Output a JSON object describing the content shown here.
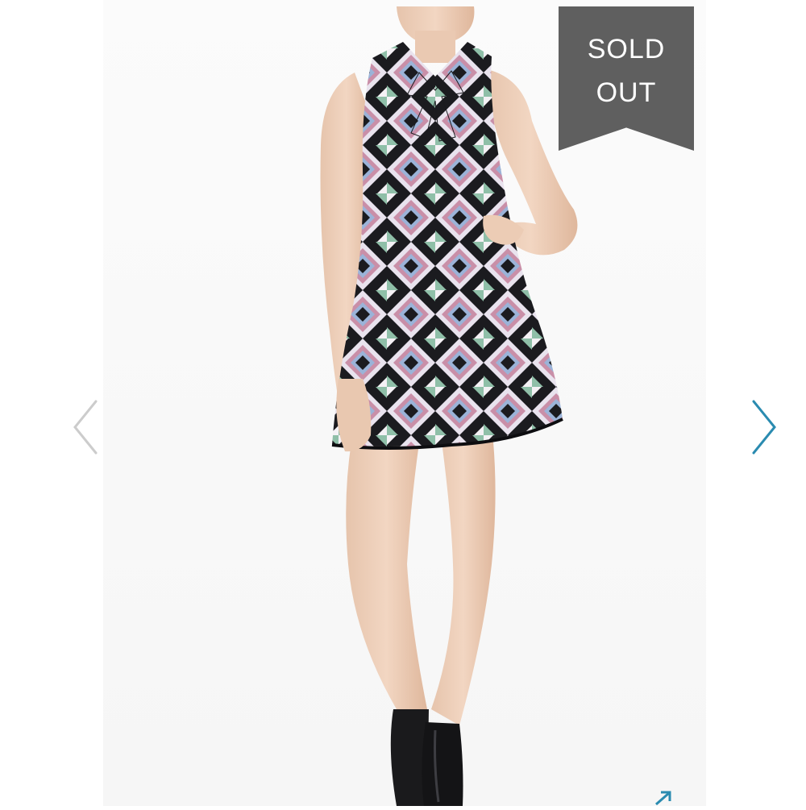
{
  "badge": {
    "line1": "SOLD",
    "line2": "OUT",
    "color": "#5f5f5f"
  },
  "gallery": {
    "prev_icon": "chevron-left-icon",
    "next_icon": "chevron-right-icon",
    "expand_icon": "expand-arrow-icon",
    "nav_color_inactive": "#cccccc",
    "nav_color_active": "#2a8bb0"
  },
  "product_image": {
    "subject": "model-wearing-geometric-print-shift-dress"
  }
}
